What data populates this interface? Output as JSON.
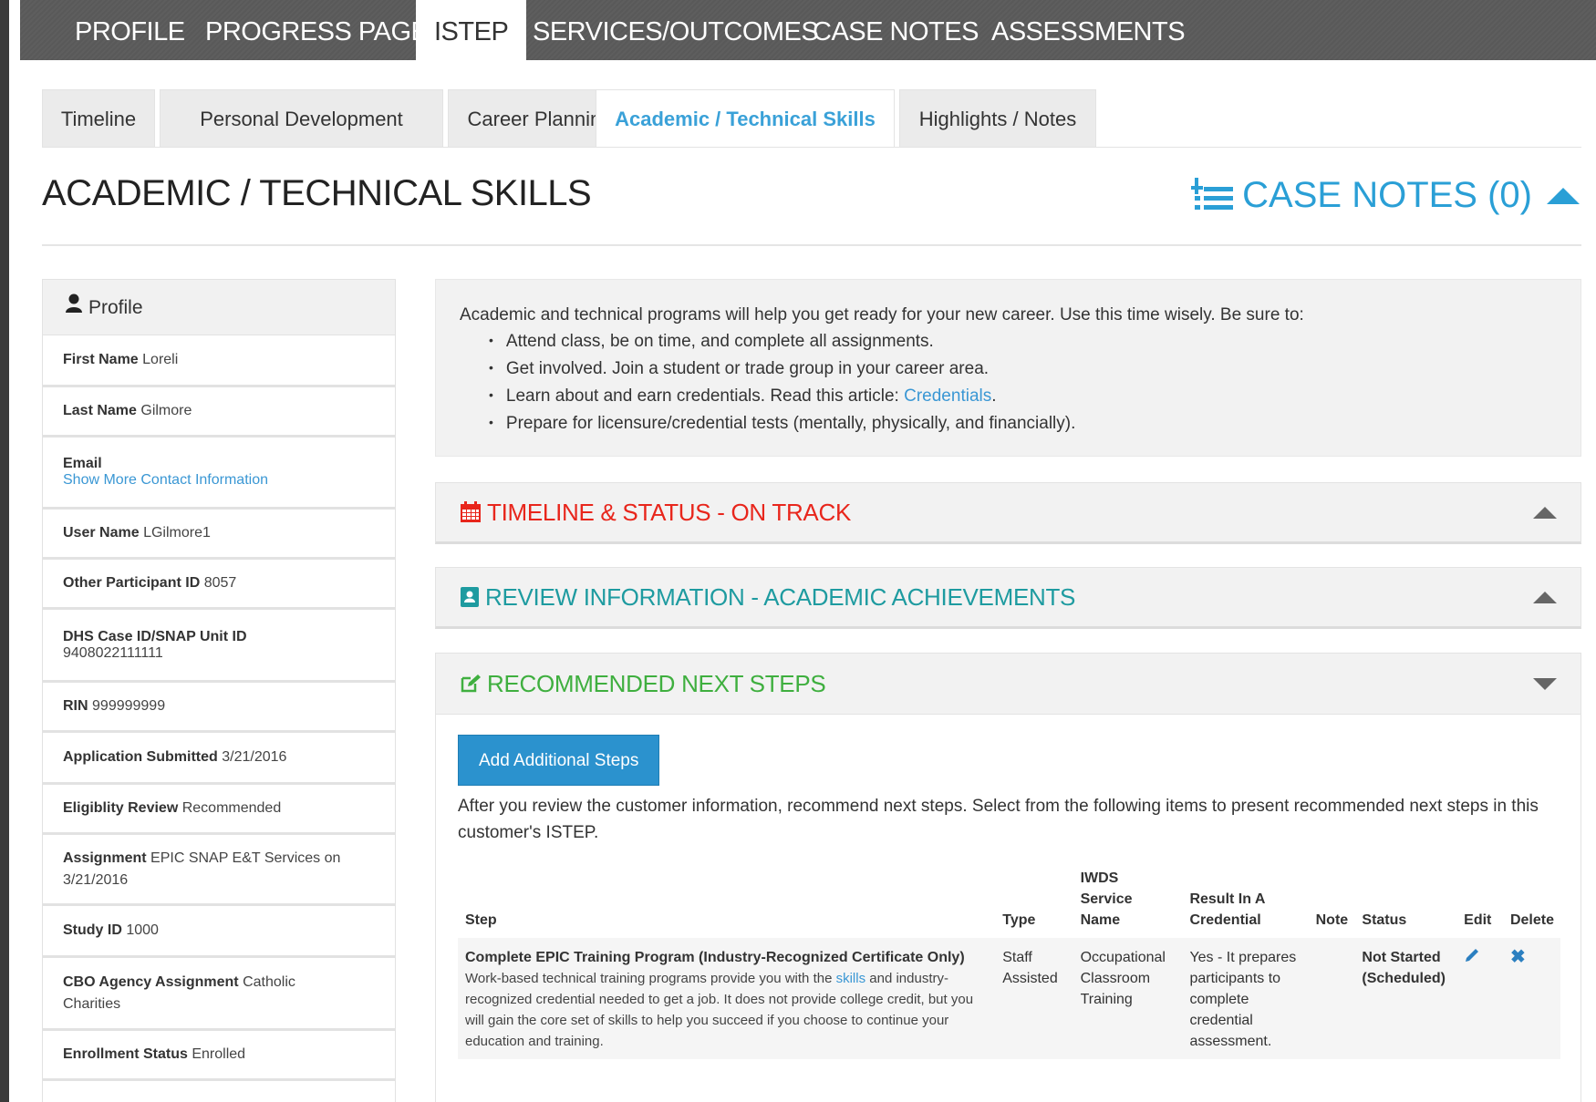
{
  "top_nav": {
    "items": [
      "PROFILE",
      "PROGRESS PAGE",
      "ISTEP",
      "SERVICES/OUTCOMES",
      "CASE NOTES",
      "ASSESSMENTS"
    ],
    "active": "ISTEP"
  },
  "sub_tabs": {
    "items": [
      "Timeline",
      "Personal Development",
      "Career Planning",
      "Academic / Technical Skills",
      "Highlights / Notes"
    ],
    "active": "Academic / Technical Skills"
  },
  "page_title": "ACADEMIC / TECHNICAL SKILLS",
  "case_notes_label": "CASE NOTES (0)",
  "profile": {
    "header": "Profile",
    "rows": [
      {
        "label": "First Name",
        "value": "Loreli"
      },
      {
        "label": "Last Name",
        "value": "Gilmore"
      },
      {
        "label": "Email",
        "value": "",
        "link": "Show More Contact Information"
      },
      {
        "label": "User Name",
        "value": "LGilmore1"
      },
      {
        "label": "Other Participant ID",
        "value": "8057"
      },
      {
        "label": "DHS Case ID/SNAP Unit ID",
        "value": "9408022111111"
      },
      {
        "label": "RIN",
        "value": "999999999"
      },
      {
        "label": "Application Submitted",
        "value": "3/21/2016"
      },
      {
        "label": "Eligiblity Review",
        "value": "Recommended"
      },
      {
        "label": "Assignment",
        "value": "EPIC SNAP E&T Services on 3/21/2016"
      },
      {
        "label": "Study ID",
        "value": "1000"
      },
      {
        "label": "CBO Agency Assignment",
        "value": "Catholic Charities"
      },
      {
        "label": "Enrollment Status",
        "value": "Enrolled"
      }
    ]
  },
  "intro": {
    "lead": "Academic and technical programs will help you get ready for your new career. Use this time wisely. Be sure to:",
    "bullets": [
      "Attend class, be on time, and complete all assignments.",
      "Get involved. Join a student or trade group in your career area.",
      "Learn about and earn credentials. Read this article: ",
      "Prepare for licensure/credential tests (mentally, physically, and financially)."
    ],
    "credentials_link": "Credentials",
    "credentials_tail": "."
  },
  "accordions": {
    "timeline": {
      "label": "TIMELINE & STATUS - ON TRACK",
      "color": "#e8261c"
    },
    "review": {
      "label": "REVIEW INFORMATION - ACADEMIC ACHIEVEMENTS",
      "color": "#1e9ba0"
    },
    "steps": {
      "label": "RECOMMENDED NEXT STEPS",
      "color": "#3faf3f"
    }
  },
  "steps": {
    "add_button": "Add Additional Steps",
    "description": "After you review the customer information, recommend next steps. Select from the following items to present recommended next steps in this customer's ISTEP.",
    "columns": {
      "step": "Step",
      "type": "Type",
      "iwds_1": "IWDS",
      "iwds_2": "Service",
      "iwds_3": "Name",
      "credential_1": "Result In A",
      "credential_2": "Credential",
      "note": "Note",
      "status": "Status",
      "edit": "Edit",
      "delete": "Delete"
    },
    "rows": [
      {
        "step_title": "Complete EPIC Training Program (Industry-Recognized Certificate Only)",
        "desc_before": "Work-based technical training programs provide you with the ",
        "desc_link": "skills",
        "desc_after": " and industry-recognized credential needed to get a job.  It does not provide college credit, but you will gain the core set of skills to help you succeed if you choose to continue your education and training.",
        "type": "Staff Assisted",
        "iwds_service": "Occupational Classroom Training",
        "credential": "Yes - It prepares participants to complete credential assessment.",
        "note": "",
        "status": "Not Started (Scheduled)"
      }
    ]
  },
  "colors": {
    "accent_blue": "#2a9fd6",
    "button_blue": "#2b92ce",
    "nav_gray": "#5c5c5c"
  }
}
